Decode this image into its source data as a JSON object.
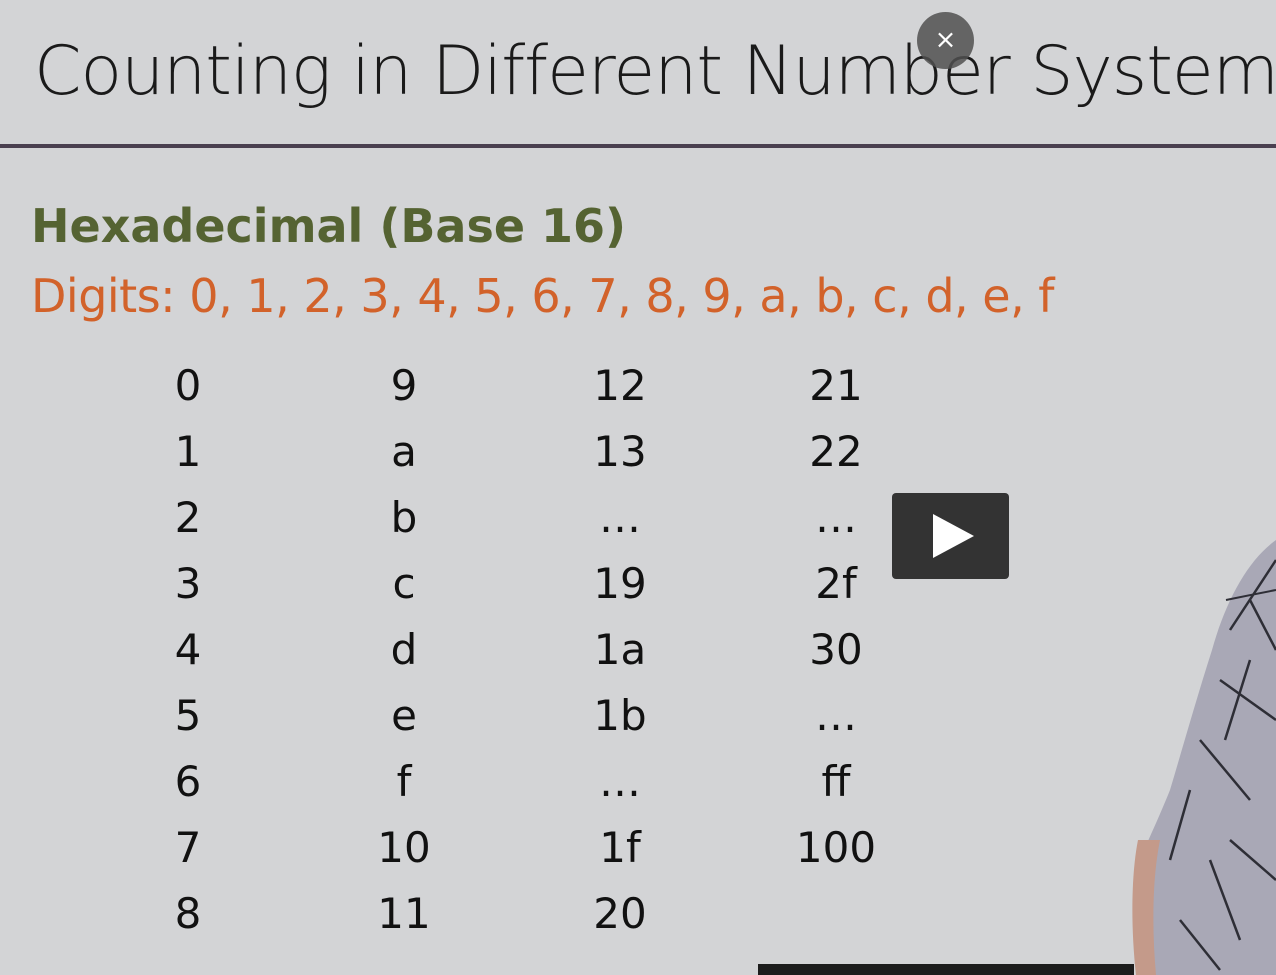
{
  "slide": {
    "title": "Counting in Different Number Systems",
    "heading": "Hexadecimal (Base 16)",
    "digits_line": "Digits: 0, 1, 2, 3, 4, 5, 6, 7, 8, 9, a, b, c, d, e, f"
  },
  "table": {
    "columns": [
      [
        "0",
        "1",
        "2",
        "3",
        "4",
        "5",
        "6",
        "7",
        "8"
      ],
      [
        "9",
        "a",
        "b",
        "c",
        "d",
        "e",
        "f",
        "10",
        "11"
      ],
      [
        "12",
        "13",
        "…",
        "19",
        "1a",
        "1b",
        "…",
        "1f",
        "20"
      ],
      [
        "21",
        "22",
        "…",
        "2f",
        "30",
        "…",
        "ff",
        "100"
      ]
    ]
  },
  "controls": {
    "close_glyph": "×",
    "close_icon": "close-icon",
    "play_icon": "play-icon"
  },
  "colors": {
    "background": "#d3d4d6",
    "heading": "#556332",
    "digits": "#d2622a",
    "rule": "#4a4050",
    "player_button": "#333333"
  }
}
